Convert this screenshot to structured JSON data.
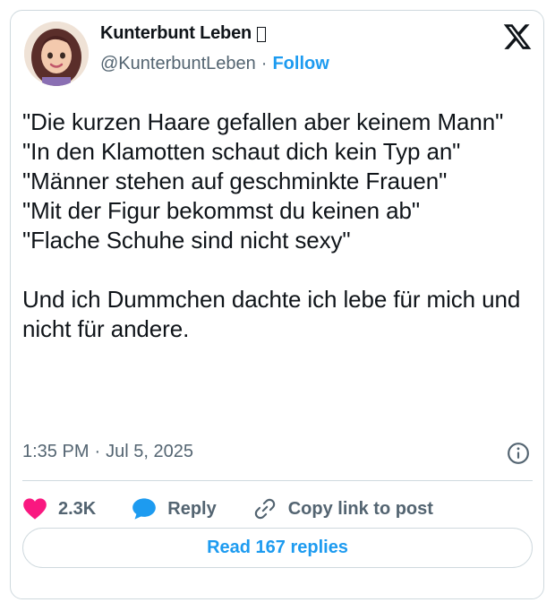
{
  "author": {
    "name": "Kunterbunt Leben",
    "handle": "@KunterbuntLeben",
    "follow_label": "Follow",
    "separator": "·"
  },
  "logo": "x-logo-icon",
  "tweet": {
    "text": "\"Die kurzen Haare gefallen aber keinem Mann\"\n\"In den Klamotten schaut dich kein Typ an\"\n\"Männer stehen auf geschminkte Frauen\"\n\"Mit der Figur bekommst du keinen ab\"\n\"Flache Schuhe sind nicht sexy\"\n\nUnd ich Dummchen dachte ich lebe für mich und nicht für andere.",
    "time": "1:35 PM",
    "date": "Jul 5, 2025"
  },
  "actions": {
    "likes": "2.3K",
    "reply_label": "Reply",
    "copy_link_label": "Copy link to post"
  },
  "read_replies_label": "Read 167 replies",
  "colors": {
    "accent": "#1d9bf0",
    "like": "#f91880",
    "text": "#0f1419",
    "secondary": "#536471",
    "border": "#cfd9de"
  }
}
